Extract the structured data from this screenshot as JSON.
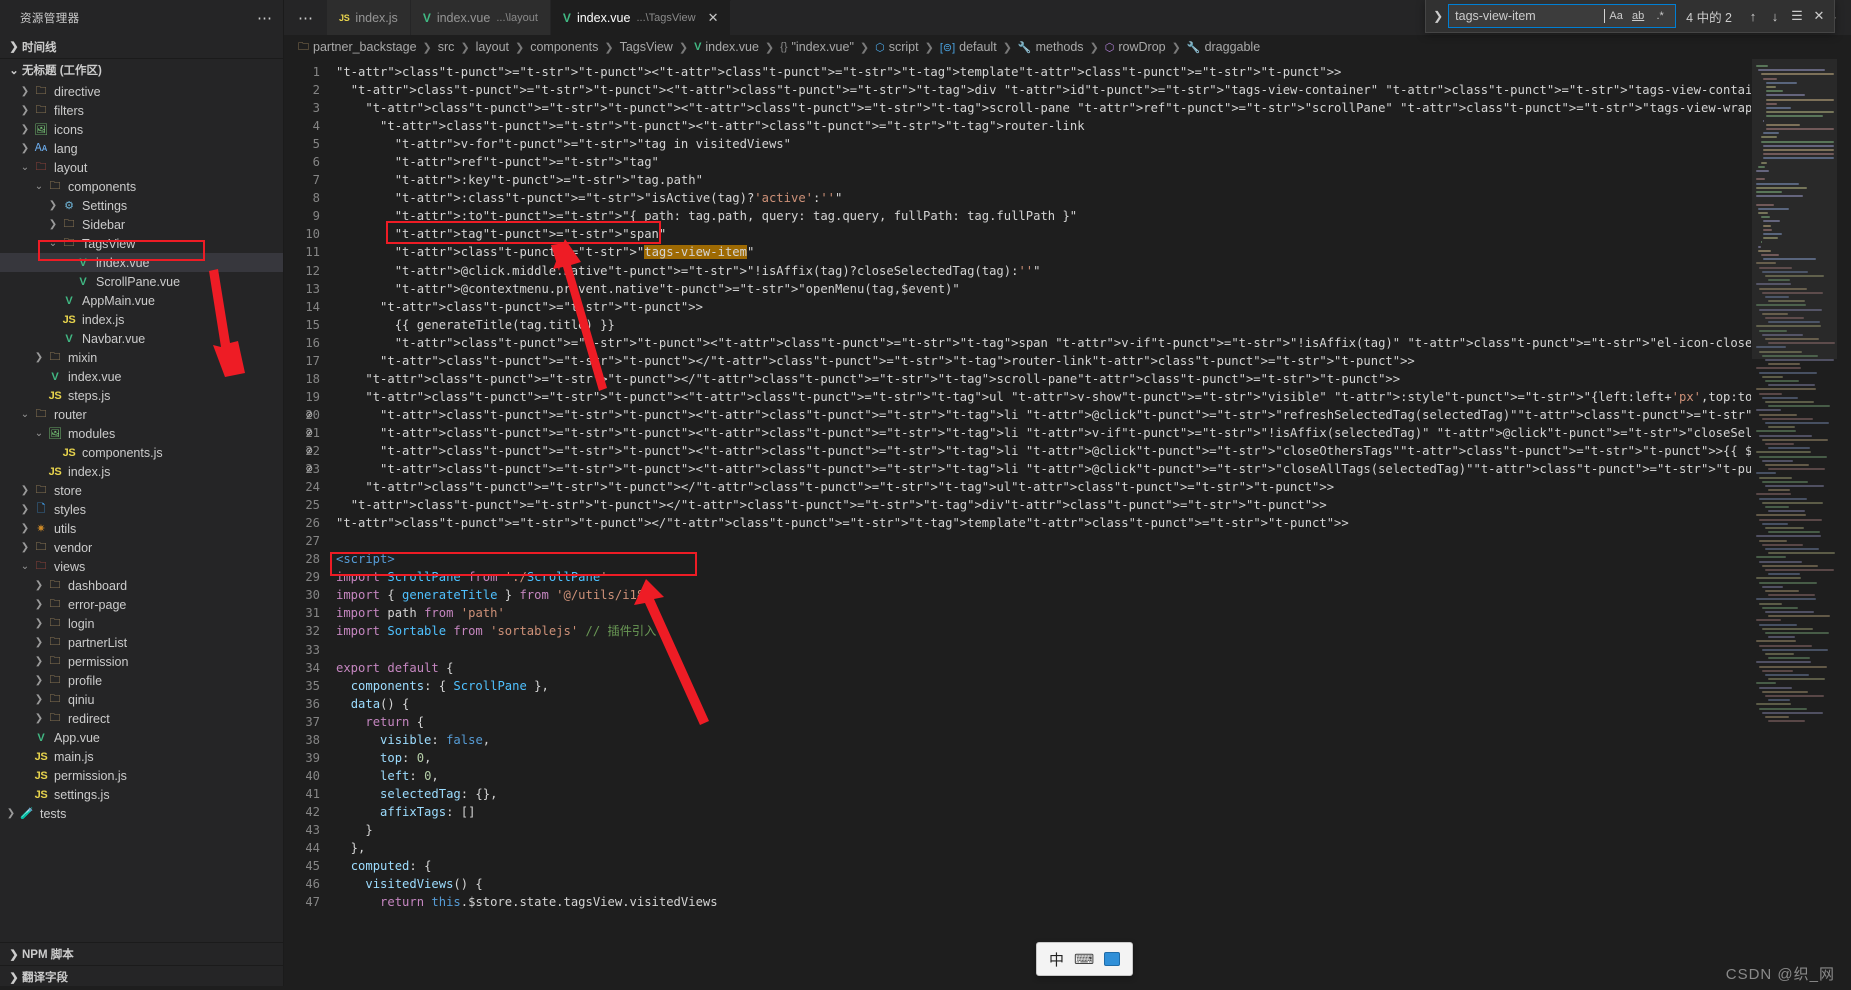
{
  "sidebar": {
    "title": "资源管理器",
    "more_icon": "ellipsis-icon",
    "sections": [
      {
        "label": "时间线",
        "expanded": false
      },
      {
        "label": "无标题 (工作区)",
        "expanded": true
      }
    ],
    "bottom_sections": [
      {
        "label": "NPM 脚本"
      },
      {
        "label": "翻译字段"
      }
    ],
    "tree": [
      {
        "label": "directive",
        "icon": "folder-icon",
        "type": "folder",
        "indent": 2,
        "twisty": ">"
      },
      {
        "label": "filters",
        "icon": "folder-icon",
        "type": "folder",
        "indent": 2,
        "twisty": ">"
      },
      {
        "label": "icons",
        "icon": "image-folder-icon",
        "type": "folder-img",
        "indent": 2,
        "twisty": ">"
      },
      {
        "label": "lang",
        "icon": "lang-folder-icon",
        "type": "folder-lang",
        "indent": 2,
        "twisty": ">"
      },
      {
        "label": "layout",
        "icon": "vue-folder-icon",
        "type": "folder-vue",
        "indent": 2,
        "twisty": "v"
      },
      {
        "label": "components",
        "icon": "components-folder-icon",
        "type": "folder-comp",
        "indent": 3,
        "twisty": "v"
      },
      {
        "label": "Settings",
        "icon": "settings-folder-icon",
        "type": "folder-gear",
        "indent": 4,
        "twisty": ">"
      },
      {
        "label": "Sidebar",
        "icon": "folder-icon",
        "type": "folder",
        "indent": 4,
        "twisty": ">"
      },
      {
        "label": "TagsView",
        "icon": "folder-icon",
        "type": "folder",
        "indent": 4,
        "twisty": "v"
      },
      {
        "label": "index.vue",
        "icon": "vue-file-icon",
        "type": "vue",
        "indent": 5,
        "twisty": "",
        "selected": true,
        "highlighted": true
      },
      {
        "label": "ScrollPane.vue",
        "icon": "vue-file-icon",
        "type": "vue",
        "indent": 5,
        "twisty": ""
      },
      {
        "label": "AppMain.vue",
        "icon": "vue-file-icon",
        "type": "vue",
        "indent": 4,
        "twisty": ""
      },
      {
        "label": "index.js",
        "icon": "js-file-icon",
        "type": "js",
        "indent": 4,
        "twisty": ""
      },
      {
        "label": "Navbar.vue",
        "icon": "vue-file-icon",
        "type": "vue",
        "indent": 4,
        "twisty": ""
      },
      {
        "label": "mixin",
        "icon": "folder-icon",
        "type": "folder",
        "indent": 3,
        "twisty": ">"
      },
      {
        "label": "index.vue",
        "icon": "vue-file-icon",
        "type": "vue",
        "indent": 3,
        "twisty": ""
      },
      {
        "label": "steps.js",
        "icon": "js-file-icon",
        "type": "js",
        "indent": 3,
        "twisty": ""
      },
      {
        "label": "router",
        "icon": "folder-icon",
        "type": "folder",
        "indent": 2,
        "twisty": "v"
      },
      {
        "label": "modules",
        "icon": "image-folder-icon",
        "type": "folder-img",
        "indent": 3,
        "twisty": "v"
      },
      {
        "label": "components.js",
        "icon": "js-file-icon",
        "type": "js",
        "indent": 4,
        "twisty": ""
      },
      {
        "label": "index.js",
        "icon": "js-file-icon",
        "type": "js",
        "indent": 3,
        "twisty": ""
      },
      {
        "label": "store",
        "icon": "folder-icon",
        "type": "folder",
        "indent": 2,
        "twisty": ">"
      },
      {
        "label": "styles",
        "icon": "css-folder-icon",
        "type": "folder-css",
        "indent": 2,
        "twisty": ">"
      },
      {
        "label": "utils",
        "icon": "utils-folder-icon",
        "type": "folder-utils",
        "indent": 2,
        "twisty": ">"
      },
      {
        "label": "vendor",
        "icon": "folder-icon",
        "type": "folder",
        "indent": 2,
        "twisty": ">"
      },
      {
        "label": "views",
        "icon": "vue-folder-icon",
        "type": "folder-vue",
        "indent": 2,
        "twisty": "v"
      },
      {
        "label": "dashboard",
        "icon": "folder-icon",
        "type": "folder",
        "indent": 3,
        "twisty": ">"
      },
      {
        "label": "error-page",
        "icon": "folder-icon",
        "type": "folder",
        "indent": 3,
        "twisty": ">"
      },
      {
        "label": "login",
        "icon": "folder-icon",
        "type": "folder",
        "indent": 3,
        "twisty": ">"
      },
      {
        "label": "partnerList",
        "icon": "folder-icon",
        "type": "folder",
        "indent": 3,
        "twisty": ">"
      },
      {
        "label": "permission",
        "icon": "folder-icon",
        "type": "folder",
        "indent": 3,
        "twisty": ">"
      },
      {
        "label": "profile",
        "icon": "folder-icon",
        "type": "folder",
        "indent": 3,
        "twisty": ">"
      },
      {
        "label": "qiniu",
        "icon": "folder-icon",
        "type": "folder",
        "indent": 3,
        "twisty": ">"
      },
      {
        "label": "redirect",
        "icon": "folder-icon",
        "type": "folder",
        "indent": 3,
        "twisty": ">"
      },
      {
        "label": "App.vue",
        "icon": "vue-file-icon",
        "type": "vue",
        "indent": 2,
        "twisty": ""
      },
      {
        "label": "main.js",
        "icon": "js-file-icon",
        "type": "js",
        "indent": 2,
        "twisty": ""
      },
      {
        "label": "permission.js",
        "icon": "js-file-icon",
        "type": "js",
        "indent": 2,
        "twisty": ""
      },
      {
        "label": "settings.js",
        "icon": "js-file-icon",
        "type": "js",
        "indent": 2,
        "twisty": ""
      },
      {
        "label": "tests",
        "icon": "tests-folder-icon",
        "type": "folder-test",
        "indent": 1,
        "twisty": ">"
      }
    ]
  },
  "tabs": {
    "more_icon": "ellipsis-icon",
    "items": [
      {
        "label": "index.js",
        "sub": "",
        "icon": "js-file-icon",
        "active": false,
        "closable": false
      },
      {
        "label": "index.vue",
        "sub": "...\\layout",
        "icon": "vue-file-icon",
        "active": false,
        "closable": false
      },
      {
        "label": "index.vue",
        "sub": "...\\TagsView",
        "icon": "vue-file-icon",
        "active": true,
        "closable": true
      }
    ],
    "actions": [
      {
        "name": "run-icon",
        "glyph": "▷"
      },
      {
        "name": "history-icon",
        "glyph": "🕘"
      },
      {
        "name": "split-editor-icon",
        "glyph": "▥"
      },
      {
        "name": "more-actions-icon",
        "glyph": "⋯"
      }
    ]
  },
  "breadcrumb": [
    {
      "label": "partner_backstage",
      "icon": "project-folder-icon"
    },
    {
      "label": "src",
      "icon": ""
    },
    {
      "label": "layout",
      "icon": ""
    },
    {
      "label": "components",
      "icon": ""
    },
    {
      "label": "TagsView",
      "icon": ""
    },
    {
      "label": "index.vue",
      "icon": "vue-file-icon"
    },
    {
      "label": "\"index.vue\"",
      "icon": "braces-icon"
    },
    {
      "label": "script",
      "icon": "script-icon"
    },
    {
      "label": "default",
      "icon": "default-export-icon"
    },
    {
      "label": "methods",
      "icon": "methods-icon"
    },
    {
      "label": "rowDrop",
      "icon": "method-icon"
    },
    {
      "label": "draggable",
      "icon": "field-icon"
    }
  ],
  "find": {
    "toggle_icon": "chevron-right-icon",
    "query": "tags-view-item",
    "options": [
      {
        "name": "match-case-toggle",
        "glyph": "Aa"
      },
      {
        "name": "match-whole-word-toggle",
        "glyph": "ab"
      },
      {
        "name": "use-regex-toggle",
        "glyph": ".*"
      }
    ],
    "count": "4 中的 2",
    "buttons": [
      {
        "name": "previous-match-button",
        "glyph": "↑"
      },
      {
        "name": "next-match-button",
        "glyph": "↓"
      },
      {
        "name": "find-in-selection-button",
        "glyph": "☰"
      },
      {
        "name": "close-find-button",
        "glyph": "✕"
      }
    ]
  },
  "ime": {
    "mode": "中",
    "keyboard_icon": "keyboard-icon",
    "panel_icon": "ime-panel-icon"
  },
  "watermark": "CSDN @织_网",
  "colors": {
    "editor_bg": "#1e1e1e",
    "sidebar_bg": "#252526",
    "tab_active_bg": "#1e1e1e",
    "tab_inactive_bg": "#2d2d2d",
    "accent": "#007fd4",
    "annotation_red": "#ee1c25",
    "match_highlight": "#623315",
    "current_match": "#9e6a03"
  },
  "code": {
    "language": "vue",
    "first_line": 1,
    "last_line": 47,
    "lines": [
      {
        "n": 1,
        "fold": false,
        "text": "<template>"
      },
      {
        "n": 2,
        "fold": false,
        "text": "  <div id=\"tags-view-container\" class=\"tags-view-container\">"
      },
      {
        "n": 3,
        "fold": false,
        "text": "    <scroll-pane ref=\"scrollPane\" class=\"tags-view-wrapper\" @scroll=\"handleScroll\">"
      },
      {
        "n": 4,
        "fold": false,
        "text": "      <router-link"
      },
      {
        "n": 5,
        "fold": false,
        "text": "        v-for=\"tag in visitedViews\""
      },
      {
        "n": 6,
        "fold": false,
        "text": "        ref=\"tag\""
      },
      {
        "n": 7,
        "fold": false,
        "text": "        :key=\"tag.path\""
      },
      {
        "n": 8,
        "fold": false,
        "text": "        :class=\"isActive(tag)?'active':''\""
      },
      {
        "n": 9,
        "fold": false,
        "text": "        :to=\"{ path: tag.path, query: tag.query, fullPath: tag.fullPath }\""
      },
      {
        "n": 10,
        "fold": false,
        "text": "        tag=\"span\""
      },
      {
        "n": 11,
        "fold": false,
        "text": "        class=\"tags-view-item\""
      },
      {
        "n": 12,
        "fold": false,
        "text": "        @click.middle.native=\"!isAffix(tag)?closeSelectedTag(tag):''\""
      },
      {
        "n": 13,
        "fold": false,
        "text": "        @contextmenu.prevent.native=\"openMenu(tag,$event)\""
      },
      {
        "n": 14,
        "fold": false,
        "text": "      >"
      },
      {
        "n": 15,
        "fold": false,
        "text": "        {{ generateTitle(tag.title) }}"
      },
      {
        "n": 16,
        "fold": false,
        "text": "        <span v-if=\"!isAffix(tag)\" class=\"el-icon-close\" @click.prevent.stop=\"closeSelectedTag(tag)\" />"
      },
      {
        "n": 17,
        "fold": false,
        "text": "      </router-link>"
      },
      {
        "n": 18,
        "fold": false,
        "text": "    </scroll-pane>"
      },
      {
        "n": 19,
        "fold": false,
        "text": "    <ul v-show=\"visible\" :style=\"{left:left+'px',top:top+'px'}\" class=\"contextmenu\">"
      },
      {
        "n": 20,
        "fold": true,
        "text": "      <li @click=\"refreshSelectedTag(selectedTag)\">{{ $t('tagsView.refresh') }}</li>"
      },
      {
        "n": 21,
        "fold": true,
        "text": "      <li v-if=\"!isAffix(selectedTag)\" @click=\"closeSelectedTag(selectedTag)\">{{ $t('tagsView.close') }}</li>"
      },
      {
        "n": 22,
        "fold": true,
        "text": "      <li @click=\"closeOthersTags\">{{ $t('tagsView.closeOthers') }}</li>"
      },
      {
        "n": 23,
        "fold": true,
        "text": "      <li @click=\"closeAllTags(selectedTag)\">{{ $t('tagsView.closeAll') }}</li>"
      },
      {
        "n": 24,
        "fold": false,
        "text": "    </ul>"
      },
      {
        "n": 25,
        "fold": false,
        "text": "  </div>"
      },
      {
        "n": 26,
        "fold": false,
        "text": "</template>"
      },
      {
        "n": 27,
        "fold": false,
        "text": ""
      },
      {
        "n": 28,
        "fold": false,
        "text": "<script>"
      },
      {
        "n": 29,
        "fold": false,
        "text": "import ScrollPane from './ScrollPane'"
      },
      {
        "n": 30,
        "fold": false,
        "text": "import { generateTitle } from '@/utils/i18n'"
      },
      {
        "n": 31,
        "fold": false,
        "text": "import path from 'path'"
      },
      {
        "n": 32,
        "fold": false,
        "text": "import Sortable from 'sortablejs' // 插件引入"
      },
      {
        "n": 33,
        "fold": false,
        "text": ""
      },
      {
        "n": 34,
        "fold": false,
        "text": "export default {"
      },
      {
        "n": 35,
        "fold": false,
        "text": "  components: { ScrollPane },"
      },
      {
        "n": 36,
        "fold": false,
        "text": "  data() {"
      },
      {
        "n": 37,
        "fold": false,
        "text": "    return {"
      },
      {
        "n": 38,
        "fold": false,
        "text": "      visible: false,"
      },
      {
        "n": 39,
        "fold": false,
        "text": "      top: 0,"
      },
      {
        "n": 40,
        "fold": false,
        "text": "      left: 0,"
      },
      {
        "n": 41,
        "fold": false,
        "text": "      selectedTag: {},"
      },
      {
        "n": 42,
        "fold": false,
        "text": "      affixTags: []"
      },
      {
        "n": 43,
        "fold": false,
        "text": "    }"
      },
      {
        "n": 44,
        "fold": false,
        "text": "  },"
      },
      {
        "n": 45,
        "fold": false,
        "text": "  computed: {"
      },
      {
        "n": 46,
        "fold": false,
        "text": "    visitedViews() {"
      },
      {
        "n": 47,
        "fold": false,
        "text": "      return this.$store.state.tagsView.visitedViews"
      }
    ]
  },
  "annotations": {
    "sidebar_box": {
      "label": "highlight-selected-file"
    },
    "code_box_1": {
      "label": "highlight-class-tags-view-item"
    },
    "code_box_2": {
      "label": "highlight-import-sortable"
    },
    "arrows": 2
  }
}
